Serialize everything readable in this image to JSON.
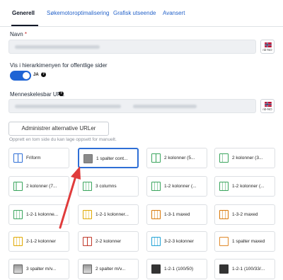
{
  "tabs": [
    {
      "label": "Generell",
      "active": true
    },
    {
      "label": "Søkemotoroptimalisering",
      "active": false
    },
    {
      "label": "Grafisk utseende",
      "active": false
    },
    {
      "label": "Avansert",
      "active": false
    }
  ],
  "form": {
    "name_label": "Navn",
    "required_mark": "*",
    "lang_code": "nb-NO",
    "hierarchy_label": "Vis i hierarkimenyen for offentlige sider",
    "toggle_value": "JA",
    "help_glyph": "?",
    "url_label": "Menneskelesbar URL",
    "admin_button": "Administrer alternative URLer",
    "layout_help": "Opprett en tom side du kan lage oppsett for manuelt."
  },
  "layouts": [
    {
      "label": "Friform",
      "icon": "blue-layout-icon",
      "selected": false
    },
    {
      "label": "1 spalter cont...",
      "icon": "grey-layout-icon",
      "selected": true
    },
    {
      "label": "2 kolonner (5...",
      "icon": "green-layout-icon",
      "selected": false
    },
    {
      "label": "2 kolonner (3...",
      "icon": "green-layout-icon",
      "selected": false
    },
    {
      "label": "2 kolonner (7...",
      "icon": "green-layout-icon",
      "selected": false
    },
    {
      "label": "3 columns",
      "icon": "green-layout-icon",
      "selected": false
    },
    {
      "label": "1-2 kolonner (...",
      "icon": "green-layout-icon",
      "selected": false
    },
    {
      "label": "1-2 kolonner (...",
      "icon": "green-layout-icon",
      "selected": false
    },
    {
      "label": "1-2-1 kolonne...",
      "icon": "green-layout-icon",
      "selected": false
    },
    {
      "label": "1-2-1 kolonner...",
      "icon": "yellow-layout-icon",
      "selected": false
    },
    {
      "label": "1-3-1 maxed",
      "icon": "orange-layout-icon",
      "selected": false
    },
    {
      "label": "1-3-2 maxed",
      "icon": "orange-layout-icon",
      "selected": false
    },
    {
      "label": "2-1-2 kolonner",
      "icon": "yellow-layout-icon",
      "selected": false
    },
    {
      "label": "2-2 kolonner",
      "icon": "red-layout-icon",
      "selected": false
    },
    {
      "label": "3-2-3 kolonner",
      "icon": "cyan-layout-icon",
      "selected": false
    },
    {
      "label": "1 spalter maxed",
      "icon": "orange-layout-icon",
      "selected": false
    },
    {
      "label": "3 spalter m/v...",
      "icon": "photo-layout-icon",
      "selected": false
    },
    {
      "label": "2 spalter m/v...",
      "icon": "photo-layout-icon",
      "selected": false
    },
    {
      "label": "1-2-1 (100/50)",
      "icon": "dark-layout-icon",
      "selected": false
    },
    {
      "label": "1-2-1 (100/33/...",
      "icon": "dark-layout-icon",
      "selected": false
    }
  ],
  "colors": {
    "accent": "#2f6fd6",
    "toggle_on": "#1f64d4",
    "arrow": "#e03b3b",
    "required": "#c62828"
  }
}
